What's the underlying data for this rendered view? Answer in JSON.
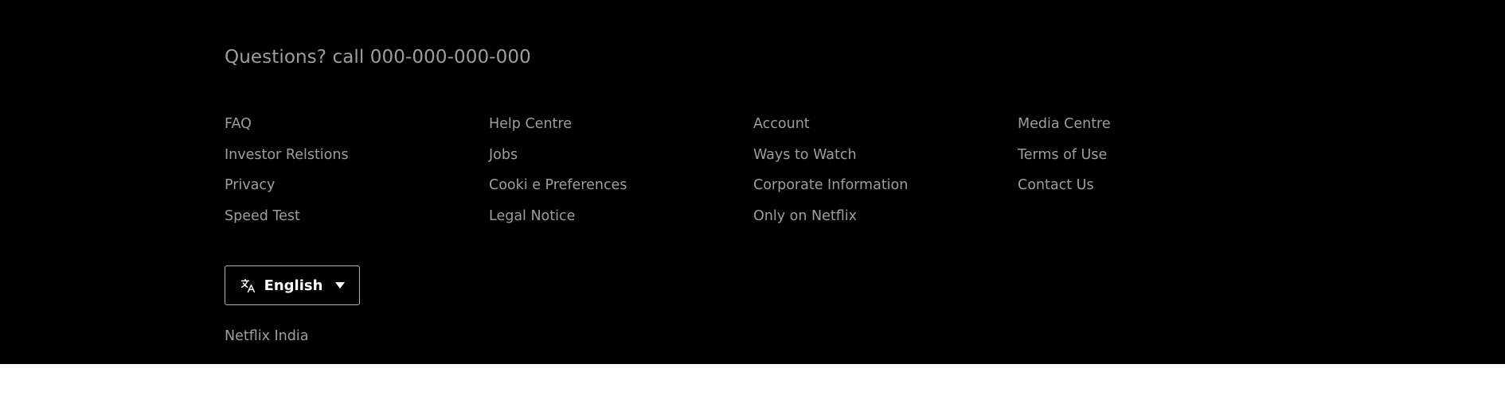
{
  "footer": {
    "questions_text": "Questions? call 000-000-000-000",
    "links": [
      [
        "FAQ",
        "Help Centre",
        "Account",
        "Media Centre"
      ],
      [
        "Investor Relstions",
        "Jobs",
        "Ways to Watch",
        "Terms of Use"
      ],
      [
        "Privacy",
        "Cooki e Preferences",
        "Corporate Information",
        "Contact Us"
      ],
      [
        "Speed Test",
        "Legal Notice",
        "Only on Netflix",
        ""
      ]
    ],
    "language": {
      "selected": "English",
      "icon": "translate-icon"
    },
    "region": "Netflix India"
  },
  "colors": {
    "background": "#000000",
    "text_muted": "#9e9e9e",
    "text_white": "#ffffff",
    "border": "#b3b3b3"
  }
}
